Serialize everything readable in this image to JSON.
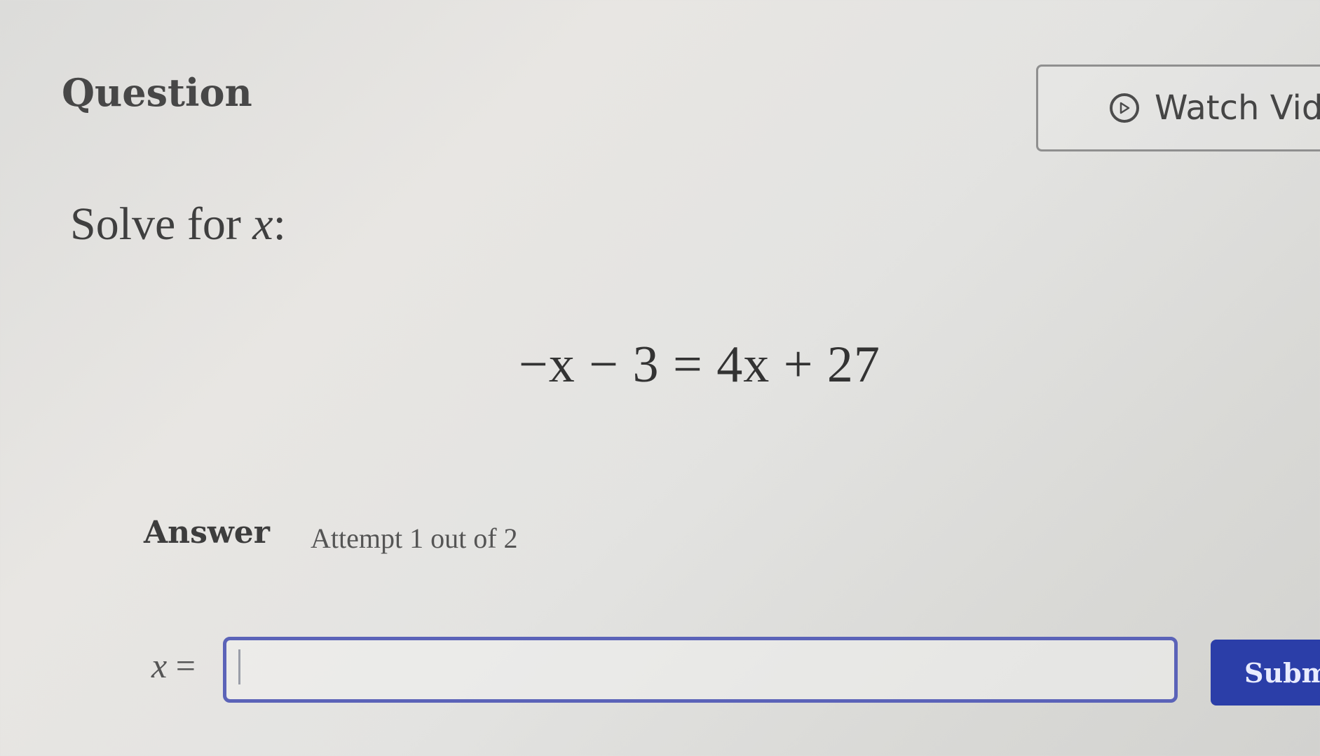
{
  "header": {
    "title": "Question",
    "watch_video_label": "Watch Vid",
    "watch_video_icon": "play-circle-icon"
  },
  "question": {
    "prompt_text": "Solve for ",
    "prompt_variable": "x",
    "prompt_suffix": ":",
    "equation": "−x − 3 = 4x + 27"
  },
  "answer": {
    "heading": "Answer",
    "attempt_text": "Attempt 1 out of 2",
    "input_variable": "x",
    "input_equals": " =",
    "input_value": "",
    "submit_label": "Submi"
  },
  "colors": {
    "input_border": "#5b63b8",
    "submit_background": "#2b3ea8"
  }
}
